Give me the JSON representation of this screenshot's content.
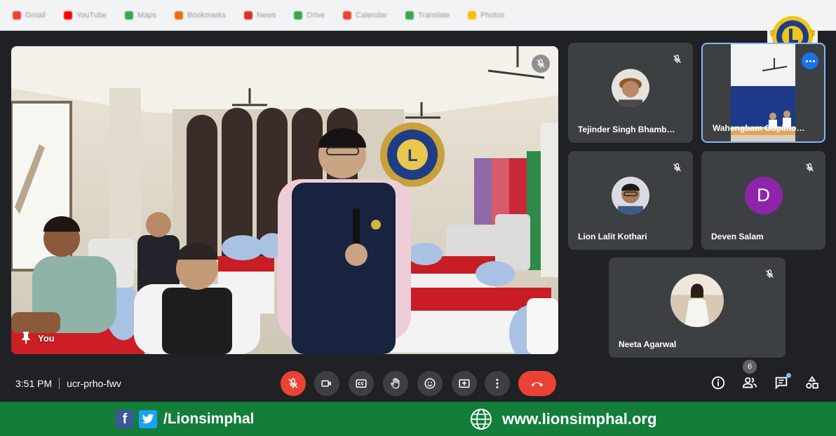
{
  "browser": {
    "bookmarks": [
      "Gmail",
      "YouTube",
      "Maps",
      "Bookmarks",
      "News",
      "Drive",
      "Calendar",
      "Translate",
      "Photos"
    ]
  },
  "meeting": {
    "time": "3:51 PM",
    "code": "ucr-prho-fwv",
    "people_count": "6"
  },
  "main_tile": {
    "label": "You",
    "mic": "mic-off-icon"
  },
  "participants": [
    {
      "name": "Tejinder Singh Bhamb…",
      "mic": "muted"
    },
    {
      "name": "Wahengbam Gopimo…",
      "mic": "speaking"
    },
    {
      "name": "Lion Lalit Kothari",
      "mic": "muted"
    },
    {
      "name": "Deven Salam",
      "initial": "D",
      "mic": "muted"
    },
    {
      "name": "Neeta Agarwal",
      "mic": "muted"
    }
  ],
  "controls": {
    "center": [
      "mic-off-icon",
      "camera-icon",
      "captions-icon",
      "raise-hand-icon",
      "emoji-icon",
      "present-icon",
      "more-options-icon",
      "end-call-icon"
    ],
    "right": [
      "info-icon",
      "people-icon",
      "chat-icon",
      "activities-icon"
    ]
  },
  "footer": {
    "handle": "/Lionsimphal",
    "website": "www.lionsimphal.org"
  },
  "colors": {
    "meet_background": "#202124",
    "tile_background": "#3c4043",
    "end_call_red": "#ea4335",
    "active_speaker_border": "#8ab4f8",
    "footer_green": "#137d3a",
    "avatar_purple": "#8e24aa"
  }
}
